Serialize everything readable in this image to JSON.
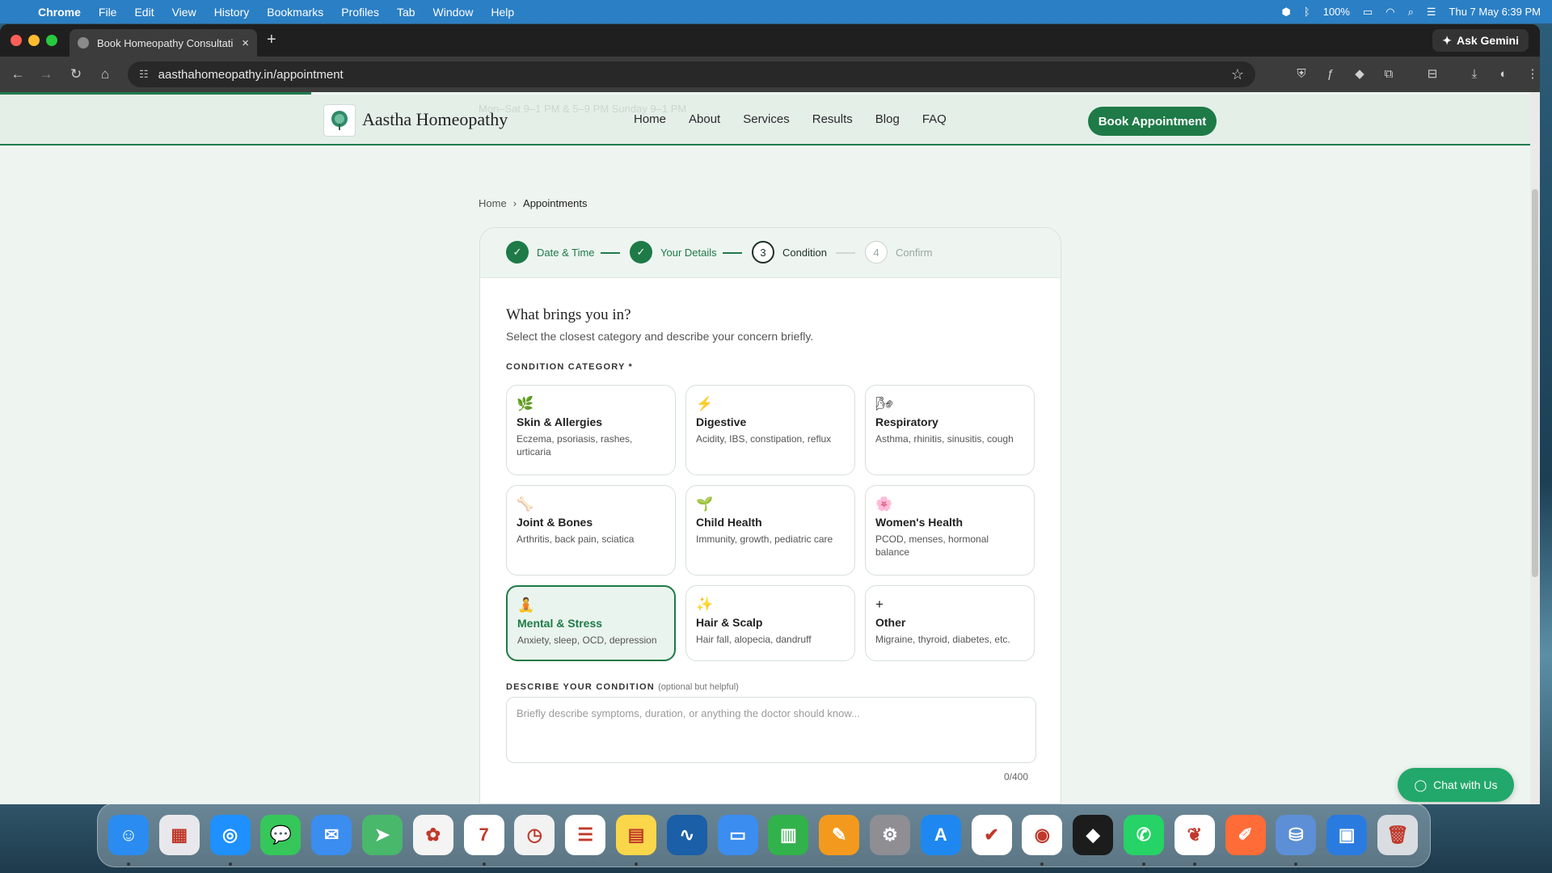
{
  "menubar": {
    "app": "Chrome",
    "items": [
      "File",
      "Edit",
      "View",
      "History",
      "Bookmarks",
      "Profiles",
      "Tab",
      "Window",
      "Help"
    ],
    "battery": "100%",
    "datetime": "Thu 7 May  6:39 PM"
  },
  "browser": {
    "tab_title": "Book Homeopathy Consultati",
    "ask_gemini": "Ask Gemini",
    "url": "aasthahomeopathy.in/appointment"
  },
  "site": {
    "name": "Aastha Homeopathy",
    "ticker": "Mon–Sat  9–1 PM & 5–9 PM   Sunday 9–1 PM",
    "nav": [
      "Home",
      "About",
      "Services",
      "Results",
      "Blog",
      "FAQ"
    ],
    "book_button": "Book Appointment"
  },
  "breadcrumb": {
    "home": "Home",
    "sep": "›",
    "current": "Appointments"
  },
  "steps": [
    {
      "num": "✓",
      "label": "Date & Time",
      "state": "done"
    },
    {
      "num": "✓",
      "label": "Your Details",
      "state": "done"
    },
    {
      "num": "3",
      "label": "Condition",
      "state": "current"
    },
    {
      "num": "4",
      "label": "Confirm",
      "state": "next"
    }
  ],
  "form": {
    "title": "What brings you in?",
    "subtitle": "Select the closest category and describe your concern briefly.",
    "category_label": "CONDITION CATEGORY *",
    "options": [
      {
        "icon": "🌿",
        "name": "Skin & Allergies",
        "desc": "Eczema, psoriasis, rashes, urticaria"
      },
      {
        "icon": "⚡",
        "name": "Digestive",
        "desc": "Acidity, IBS, constipation, reflux"
      },
      {
        "icon": "🌬",
        "name": "Respiratory",
        "desc": "Asthma, rhinitis, sinusitis, cough"
      },
      {
        "icon": "🦴",
        "name": "Joint & Bones",
        "desc": "Arthritis, back pain, sciatica"
      },
      {
        "icon": "🌱",
        "name": "Child Health",
        "desc": "Immunity, growth, pediatric care"
      },
      {
        "icon": "🌸",
        "name": "Women's Health",
        "desc": "PCOD, menses, hormonal balance"
      },
      {
        "icon": "🧘",
        "name": "Mental & Stress",
        "desc": "Anxiety, sleep, OCD, depression",
        "selected": true
      },
      {
        "icon": "✨",
        "name": "Hair & Scalp",
        "desc": "Hair fall, alopecia, dandruff"
      },
      {
        "icon": "+",
        "name": "Other",
        "desc": "Migraine, thyroid, diabetes, etc."
      }
    ],
    "describe_label": "DESCRIBE YOUR CONDITION",
    "describe_optional": "(optional but helpful)",
    "placeholder": "Briefly describe symptoms, duration, or anything the doctor should know...",
    "counter": "0/400"
  },
  "chat_button": "Chat with Us",
  "colors": {
    "primary": "#1e7a47",
    "chat": "#22a86a",
    "page_bg": "#eef5f0"
  },
  "dock_apps": [
    {
      "name": "finder",
      "color": "#2a8cf0",
      "glyph": "☺"
    },
    {
      "name": "launchpad",
      "color": "#e8e8ec",
      "glyph": "▦"
    },
    {
      "name": "safari",
      "color": "#1e90ff",
      "glyph": "◎"
    },
    {
      "name": "messages",
      "color": "#35c759",
      "glyph": "💬"
    },
    {
      "name": "mail",
      "color": "#3b8df0",
      "glyph": "✉"
    },
    {
      "name": "maps",
      "color": "#49b86b",
      "glyph": "➤"
    },
    {
      "name": "photos",
      "color": "#f4f4f4",
      "glyph": "✿"
    },
    {
      "name": "calendar",
      "color": "#ffffff",
      "glyph": "7"
    },
    {
      "name": "clock",
      "color": "#f2f2f2",
      "glyph": "◷"
    },
    {
      "name": "reminders",
      "color": "#ffffff",
      "glyph": "☰"
    },
    {
      "name": "notes",
      "color": "#f9d64a",
      "glyph": "▤"
    },
    {
      "name": "freeform",
      "color": "#1a5fa8",
      "glyph": "∿"
    },
    {
      "name": "keynote",
      "color": "#3b8df0",
      "glyph": "▭"
    },
    {
      "name": "numbers",
      "color": "#32b24a",
      "glyph": "▥"
    },
    {
      "name": "pages",
      "color": "#f39a1e",
      "glyph": "✎"
    },
    {
      "name": "system-settings",
      "color": "#8e8e93",
      "glyph": "⚙"
    },
    {
      "name": "app-store",
      "color": "#1e88f0",
      "glyph": "A"
    },
    {
      "name": "tasks",
      "color": "#ffffff",
      "glyph": "✔"
    },
    {
      "name": "chrome",
      "color": "#ffffff",
      "glyph": "◉"
    },
    {
      "name": "cursor",
      "color": "#1c1c1c",
      "glyph": "◆"
    },
    {
      "name": "whatsapp",
      "color": "#25d366",
      "glyph": "✆"
    },
    {
      "name": "mongodb",
      "color": "#ffffff",
      "glyph": "❦"
    },
    {
      "name": "postman",
      "color": "#ff6c37",
      "glyph": "✐"
    },
    {
      "name": "database",
      "color": "#5c8fd6",
      "glyph": "⛁"
    },
    {
      "name": "remote-desktop",
      "color": "#2a7be0",
      "glyph": "▣"
    },
    {
      "name": "trash",
      "color": "#d9dde2",
      "glyph": "🗑"
    }
  ]
}
